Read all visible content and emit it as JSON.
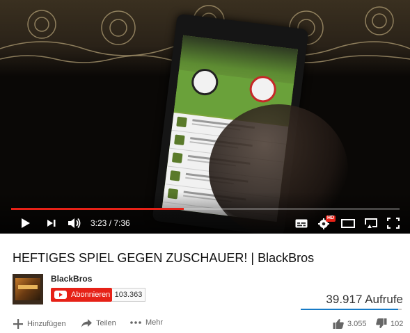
{
  "player": {
    "current_time": "3:23",
    "duration": "7:36",
    "time_display": "3:23 / 7:36",
    "played_fraction": 0.4452,
    "buffered_fraction": 0.4,
    "hd_badge": "HD",
    "icons": {
      "play": "play-icon",
      "next": "next-icon",
      "volume": "volume-icon",
      "subtitles": "subtitles-icon",
      "settings": "settings-gear-icon",
      "theater": "theater-mode-icon",
      "cast": "cast-icon",
      "fullscreen": "fullscreen-icon"
    },
    "accent": "#e62117"
  },
  "video": {
    "title": "HEFTIGES SPIEL GEGEN ZUSCHAUER! | BlackBros"
  },
  "channel": {
    "name": "BlackBros",
    "subscribe_label": "Abonnieren",
    "subscriber_count": "103.363"
  },
  "stats": {
    "views": "39.917 Aufrufe",
    "likes": "3.055",
    "dislikes": "102",
    "like_color": "#167ac6"
  },
  "actions": {
    "add_label": "Hinzufügen",
    "share_label": "Teilen",
    "more_label": "Mehr"
  }
}
